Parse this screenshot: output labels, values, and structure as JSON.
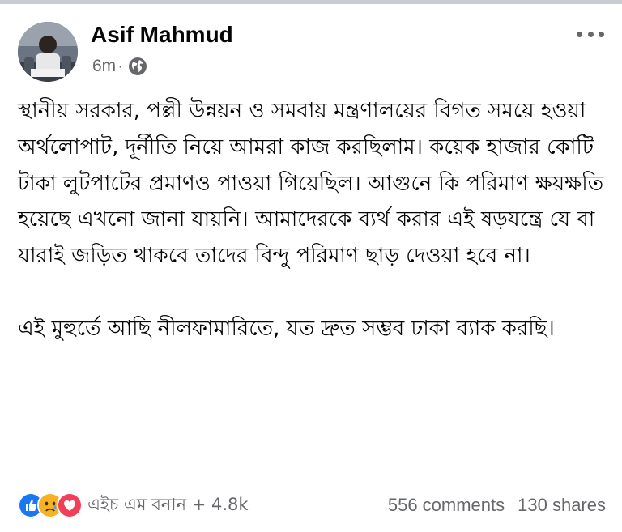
{
  "post": {
    "author": {
      "name": "Asif Mahmud"
    },
    "meta": {
      "time": "6m",
      "separator": "·",
      "privacy_icon": "globe-icon"
    },
    "options_icon": "more-horizontal-icon",
    "body": {
      "paragraphs": [
        "স্থানীয় সরকার, পল্লী উন্নয়ন ও সমবায় মন্ত্রণালয়ের বিগত সময়ে হওয়া অর্থলোপাট, দূর্নীতি নিয়ে আমরা কাজ করছিলাম। কয়েক হাজার কোটি টাকা লুটপাটের প্রমাণও পাওয়া গিয়েছিল। আগুনে কি পরিমাণ ক্ষয়ক্ষতি হয়েছে এখনো জানা যায়নি। আমাদেরকে ব্যর্থ করার এই ষড়যন্ত্রে যে বা যারাই জড়িত থাকবে তাদের বিন্দু পরিমাণ ছাড় দেওয়া হবে না।",
        "এই মুহুর্তে আছি নীলফামারিতে, যত দ্রুত সম্ভব ঢাকা ব্যাক করছি।"
      ]
    },
    "reactions": {
      "icons": [
        "like-icon",
        "sad-icon",
        "love-icon"
      ],
      "summary": "এইচ এম বনান + 4.8k"
    },
    "counts": {
      "comments": "556 comments",
      "shares": "130 shares"
    },
    "colors": {
      "like": "#1877f2",
      "sad": "#f7b125",
      "love": "#f33e58",
      "secondary_text": "#65676b"
    }
  }
}
